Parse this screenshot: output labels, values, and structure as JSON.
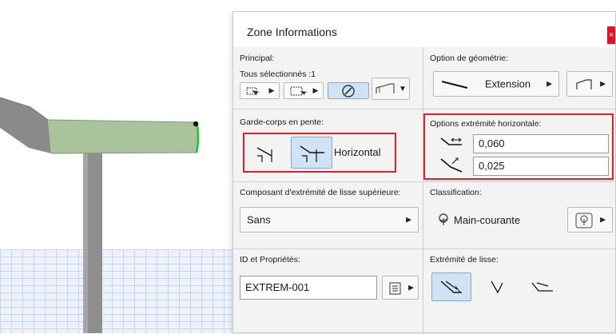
{
  "palette": {
    "title": "Zone Informations",
    "close_glyph": "×",
    "principal": {
      "label": "Principal:",
      "selection_info": "Tous sélectionnés :1",
      "buttons": [
        "select-elements-icon",
        "marquee-select-icon",
        "magic-wand-icon",
        "railing-view-icon"
      ]
    },
    "geometry": {
      "label": "Option de géométrie:",
      "value": "Extension",
      "icons": [
        "extension-line-icon",
        "corner-end-icon"
      ]
    },
    "slope_railing": {
      "label": "Garde-corps en pente:",
      "option": "Horizontal",
      "icons": [
        "slope-end-icon",
        "horizontal-end-icon"
      ]
    },
    "horizontal_end": {
      "label": "Options extrémité horizontale:",
      "length": "0,060",
      "offset": "0,025",
      "icons": [
        "horizontal-length-icon",
        "diagonal-offset-icon"
      ]
    },
    "top_rail_end": {
      "label": "Composant d'extrémité de lisse supérieure:",
      "value": "Sans"
    },
    "classification": {
      "label": "Classification:",
      "value": "Main-courante",
      "icons": [
        "classification-tree-icon",
        "classification-picker-icon"
      ]
    },
    "id_props": {
      "label": "ID et Propriétés:",
      "id": "EXTREM-001",
      "icons": [
        "properties-list-icon"
      ]
    },
    "rail_end": {
      "label": "Extrémité de lisse:",
      "icons": [
        "rail-end-mitered-icon",
        "rail-end-angle-icon",
        "rail-end-flat-icon"
      ]
    }
  },
  "colors": {
    "highlight": "#e0202b",
    "active_button": "#cfe3f5",
    "rail_green": "#a8c49a",
    "post_gray": "#8a8a8a"
  }
}
